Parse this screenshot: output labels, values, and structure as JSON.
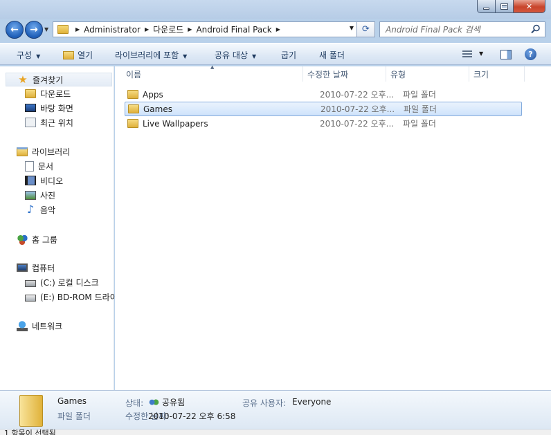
{
  "address": {
    "crumbs": [
      "Administrator",
      "다운로드",
      "Android Final Pack"
    ]
  },
  "search": {
    "placeholder": "Android Final Pack 검색"
  },
  "toolbar": {
    "organize": "구성",
    "open": "열기",
    "include_library": "라이브러리에 포함",
    "share_with": "공유 대상",
    "burn": "굽기",
    "new_folder": "새 폴더"
  },
  "sidebar": {
    "favorites": "즐겨찾기",
    "favorites_items": [
      "다운로드",
      "바탕 화면",
      "최근 위치"
    ],
    "libraries": "라이브러리",
    "libraries_items": [
      "문서",
      "비디오",
      "사진",
      "음악"
    ],
    "homegroup": "홈 그룹",
    "computer": "컴퓨터",
    "computer_items": [
      "(C:) 로컬 디스크",
      "(E:) BD-ROM 드라이"
    ],
    "network": "네트워크"
  },
  "columns": {
    "name": "이름",
    "date": "수정한 날짜",
    "type": "유형",
    "size": "크기"
  },
  "files": [
    {
      "name": "Apps",
      "date": "2010-07-22 오후...",
      "type": "파일 폴더"
    },
    {
      "name": "Games",
      "date": "2010-07-22 오후...",
      "type": "파일 폴더"
    },
    {
      "name": "Live Wallpapers",
      "date": "2010-07-22 오후...",
      "type": "파일 폴더"
    }
  ],
  "details": {
    "name": "Games",
    "state_label": "상태:",
    "state_value": "공유됨",
    "shared_users_label": "공유 사용자:",
    "shared_users_value": "Everyone",
    "kind": "파일 폴더",
    "modified_label": "수정한 날짜:",
    "modified_value": "2010-07-22 오후 6:58"
  },
  "status": {
    "selection": "1 항목이 선택됨"
  },
  "colors": {
    "selection_border": "#84acdd",
    "selection_fill": "#cfe3fb",
    "toolbar_text": "#1e3a5f"
  }
}
